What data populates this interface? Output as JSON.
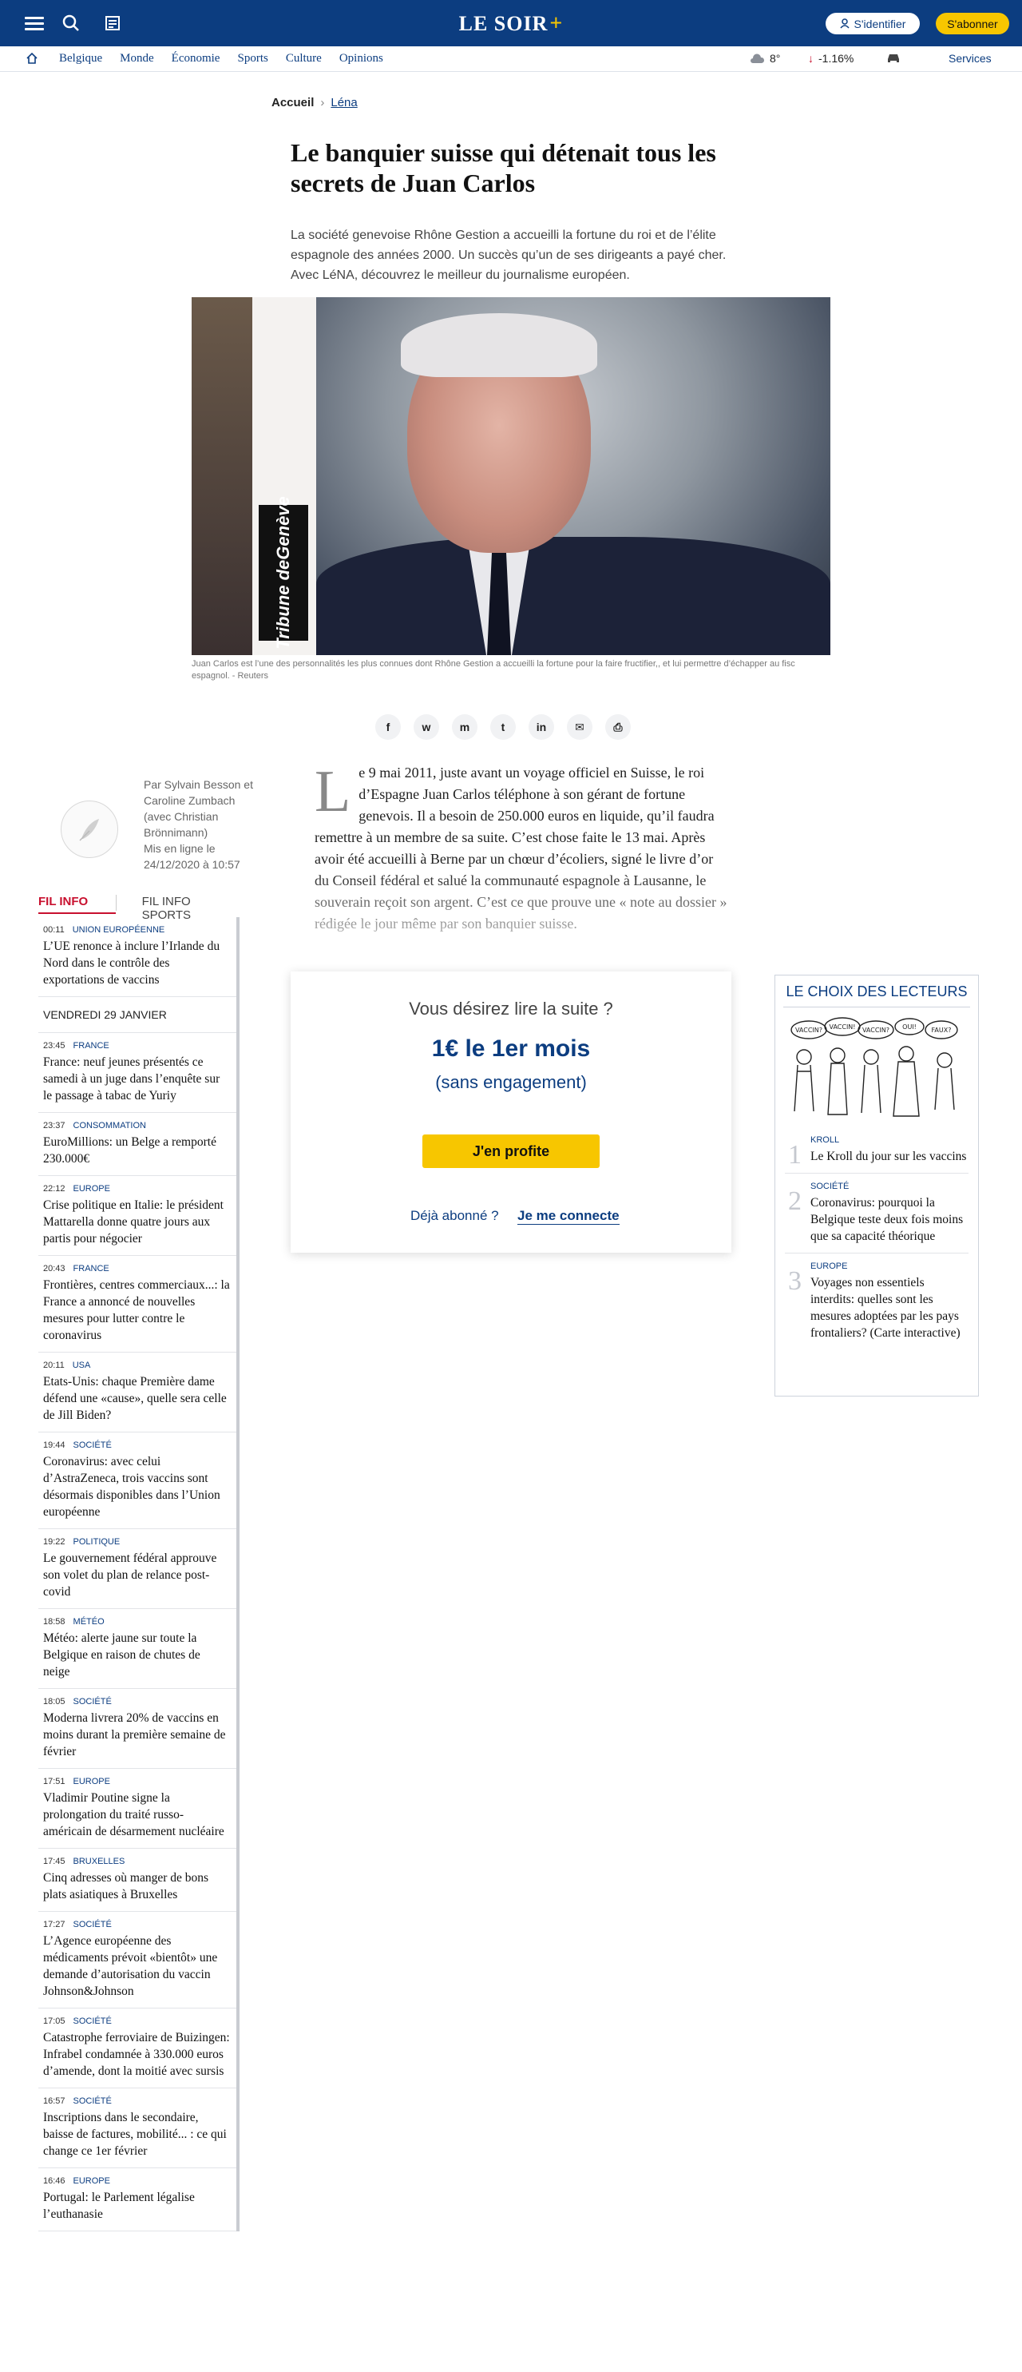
{
  "brand": {
    "name": "LE SOIR",
    "plus": "+"
  },
  "header": {
    "login_label": "S'identifier",
    "subscribe_label": "S'abonner"
  },
  "nav": {
    "items": [
      "Belgique",
      "Monde",
      "Économie",
      "Sports",
      "Culture",
      "Opinions"
    ],
    "weather": "8°",
    "bourse": "-1.16%",
    "services": "Services"
  },
  "breadcrumb": {
    "home": "Accueil",
    "current": "Léna"
  },
  "article": {
    "title": "Le banquier suisse qui détenait tous les secrets de Juan Carlos",
    "lead": "La société genevoise Rhône Gestion a accueilli la fortune du roi et de l’élite espagnole des années 2000. Un succès qu’un de ses dirigeants a payé cher. Avec LéNA, découvrez le meilleur du journalisme européen.",
    "image_brand": "Tribune deGenève",
    "caption": "Juan Carlos est l’une des personnalités les plus connues dont Rhône Gestion a accueilli la fortune pour la faire fructifier,, et lui permettre d’échapper au fisc espagnol. - Reuters",
    "author": "Par Sylvain Besson et Caroline Zumbach (avec Christian Brönnimann)",
    "date": "Mis en ligne le 24/12/2020 à 10:57",
    "dropcap": "L",
    "body": "e 9 mai 2011, juste avant un voyage officiel en Suisse, le roi d’Espagne Juan Carlos téléphone à son gérant de fortune genevois. Il a besoin de 250.000 euros en liquide, qu’il faudra remettre à un membre de sa suite. C’est chose faite le 13 mai. Après avoir été accueilli à Berne par un chœur d’écoliers, signé le livre d’or du Conseil fédéral et salué la communauté espagnole à Lausanne, le souverain reçoit son argent. C’est ce que prouve une « note au dossier » rédigée le jour même par son banquier suisse."
  },
  "share": [
    "f",
    "w",
    "m",
    "t",
    "in",
    "✉",
    "⎙"
  ],
  "paywall": {
    "question": "Vous désirez lire la suite ?",
    "offer": "1€ le 1er mois",
    "sub": "(sans engagement)",
    "cta": "J'en profite",
    "already": "Déjà abonné ?",
    "connect": "Je me connecte"
  },
  "fil": {
    "tab_active": "FIL INFO",
    "tab_other": "FIL INFO SPORTS",
    "first": {
      "time": "00:11",
      "cat": "UNION EUROPÉENNE",
      "title": "L’UE renonce à inclure l’Irlande du Nord dans le contrôle des exportations de vaccins"
    },
    "day": "VENDREDI 29 JANVIER",
    "items": [
      {
        "time": "23:45",
        "cat": "FRANCE",
        "title": "France: neuf jeunes présentés ce samedi à un juge dans l’enquête sur le passage à tabac de Yuriy"
      },
      {
        "time": "23:37",
        "cat": "CONSOMMATION",
        "title": "EuroMillions: un Belge a remporté 230.000€"
      },
      {
        "time": "22:12",
        "cat": "EUROPE",
        "title": "Crise politique en Italie: le président Mattarella donne quatre jours aux partis pour négocier"
      },
      {
        "time": "20:43",
        "cat": "FRANCE",
        "title": "Frontières, centres commerciaux...: la France a annoncé de nouvelles mesures pour lutter contre le coronavirus"
      },
      {
        "time": "20:11",
        "cat": "USA",
        "title": "Etats-Unis: chaque Première dame défend une «cause», quelle sera celle de Jill Biden?"
      },
      {
        "time": "19:44",
        "cat": "SOCIÉTÉ",
        "title": "Coronavirus: avec celui d’AstraZeneca, trois vaccins sont désormais disponibles dans l’Union européenne"
      },
      {
        "time": "19:22",
        "cat": "POLITIQUE",
        "title": "Le gouvernement fédéral approuve son volet du plan de relance post-covid"
      },
      {
        "time": "18:58",
        "cat": "MÉTÉO",
        "title": "Météo: alerte jaune sur toute la Belgique en raison de chutes de neige"
      },
      {
        "time": "18:05",
        "cat": "SOCIÉTÉ",
        "title": "Moderna livrera 20% de vaccins en moins durant la première semaine de février"
      },
      {
        "time": "17:51",
        "cat": "EUROPE",
        "title": "Vladimir Poutine signe la prolongation du traité russo-américain de désarmement nucléaire"
      },
      {
        "time": "17:45",
        "cat": "BRUXELLES",
        "title": "Cinq adresses où manger de bons plats asiatiques à Bruxelles"
      },
      {
        "time": "17:27",
        "cat": "SOCIÉTÉ",
        "title": "L’Agence européenne des médicaments prévoit «bientôt» une demande d’autorisation du vaccin Johnson&Johnson"
      },
      {
        "time": "17:05",
        "cat": "SOCIÉTÉ",
        "title": "Catastrophe ferroviaire de Buizingen: Infrabel condamnée à 330.000 euros d’amende, dont la moitié avec sursis"
      },
      {
        "time": "16:57",
        "cat": "SOCIÉTÉ",
        "title": "Inscriptions dans le secondaire, baisse de factures, mobilité... : ce qui change ce 1er février"
      },
      {
        "time": "16:46",
        "cat": "EUROPE",
        "title": "Portugal: le Parlement légalise l’euthanasie"
      }
    ]
  },
  "choix": {
    "title": "LE CHOIX DES LECTEURS",
    "bubbles": [
      "VACCIN?",
      "VACCIN!",
      "VACCIN?",
      "OUI!",
      "FAUX?"
    ],
    "items": [
      {
        "num": "1",
        "cat": "KROLL",
        "title": "Le Kroll du jour sur les vaccins"
      },
      {
        "num": "2",
        "cat": "SOCIÉTÉ",
        "title": "Coronavirus: pourquoi la Belgique teste deux fois moins que sa capacité théorique"
      },
      {
        "num": "3",
        "cat": "EUROPE",
        "title": "Voyages non essentiels interdits: quelles sont les mesures adoptées par les pays frontaliers? (Carte interactive)"
      }
    ]
  },
  "colors": {
    "brand_blue": "#0c3d80",
    "accent_yellow": "#f7c600",
    "fil_red": "#c8102e"
  }
}
